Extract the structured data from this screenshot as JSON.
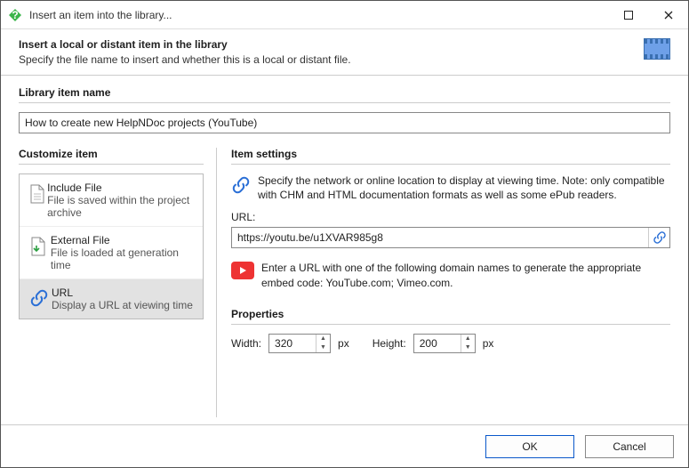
{
  "window": {
    "title": "Insert an item into the library..."
  },
  "header": {
    "title": "Insert a local or distant item in the library",
    "subtitle": "Specify the file name to insert and whether this is a local or distant file."
  },
  "nameSection": {
    "label": "Library item name",
    "value": "How to create new HelpNDoc projects (YouTube)"
  },
  "customize": {
    "label": "Customize item",
    "items": [
      {
        "title": "Include File",
        "desc": "File is saved within the project archive"
      },
      {
        "title": "External File",
        "desc": "File is loaded at generation time"
      },
      {
        "title": "URL",
        "desc": "Display a URL at viewing time"
      }
    ]
  },
  "settings": {
    "label": "Item settings",
    "desc": "Specify the network or online location to display at viewing time. Note: only compatible with CHM and HTML documentation formats as well as some ePub readers.",
    "urlLabel": "URL:",
    "urlValue": "https://youtu.be/u1XVAR985g8",
    "hint": "Enter a URL with one of the following domain names to generate the appropriate embed code: YouTube.com; Vimeo.com."
  },
  "props": {
    "label": "Properties",
    "widthLabel": "Width:",
    "widthValue": "320",
    "heightLabel": "Height:",
    "heightValue": "200",
    "unit": "px"
  },
  "footer": {
    "ok": "OK",
    "cancel": "Cancel"
  }
}
